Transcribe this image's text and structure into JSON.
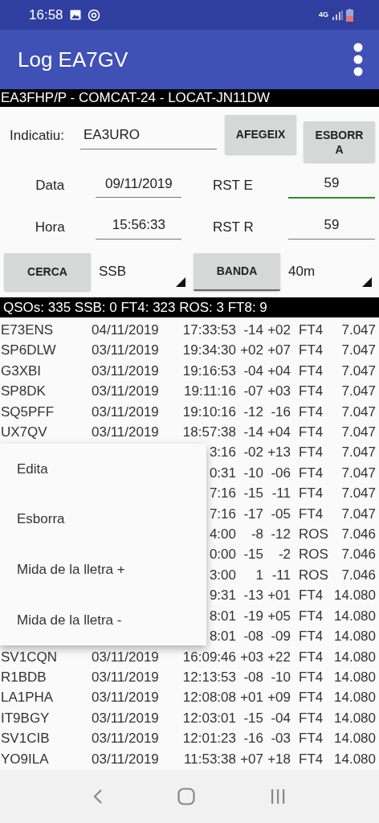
{
  "status_bar": {
    "time": "16:58",
    "network": "4G"
  },
  "app_bar": {
    "title": "Log EA7GV"
  },
  "info_banner": "EA3FHP/P - COMCAT-24 - LOCAT-JN11DW",
  "form": {
    "callsign": {
      "label": "Indicatiu:",
      "value": "EA3URO"
    },
    "buttons": [
      {
        "kind": "add",
        "label": "AFEGEIX"
      },
      {
        "kind": "delete",
        "label": "ESBORRA"
      }
    ],
    "fields": [
      {
        "label": "Data",
        "value": "09/11/2019",
        "focused": false
      },
      {
        "label": "RST E",
        "value": "59",
        "focused": true
      },
      {
        "label": "Hora",
        "value": "15:56:33",
        "focused": false
      },
      {
        "label": "RST R",
        "value": "59",
        "focused": false
      }
    ],
    "search_button": "CERCA",
    "mode_dropdown": "SSB",
    "band_button": "BANDA",
    "band_dropdown": "40m"
  },
  "stats": "QSOs: 335 SSB: 0  FT4: 323  ROS: 3  FT8: 9",
  "log_rows": [
    {
      "call": "E73ENS",
      "date": "04/11/2019",
      "time": "17:33:53",
      "rst_sent": "-14",
      "rst_rcvd": "+02",
      "mode": "FT4",
      "freq": "7.047"
    },
    {
      "call": "SP6DLW",
      "date": "03/11/2019",
      "time": "19:34:30",
      "rst_sent": "+02",
      "rst_rcvd": "+07",
      "mode": "FT4",
      "freq": "7.047"
    },
    {
      "call": "G3XBI",
      "date": "03/11/2019",
      "time": "19:16:53",
      "rst_sent": "-04",
      "rst_rcvd": "+04",
      "mode": "FT4",
      "freq": "7.047"
    },
    {
      "call": "SP8DK",
      "date": "03/11/2019",
      "time": "19:11:16",
      "rst_sent": "-07",
      "rst_rcvd": "+03",
      "mode": "FT4",
      "freq": "7.047"
    },
    {
      "call": "SQ5PFF",
      "date": "03/11/2019",
      "time": "19:10:16",
      "rst_sent": "-12",
      "rst_rcvd": "-16",
      "mode": "FT4",
      "freq": "7.047"
    },
    {
      "call": "UX7QV",
      "date": "03/11/2019",
      "time": "18:57:38",
      "rst_sent": "-14",
      "rst_rcvd": "+04",
      "mode": "FT4",
      "freq": "7.047"
    },
    {
      "time": "3:16",
      "rst_sent": "-02",
      "rst_rcvd": "+13",
      "mode": "FT4",
      "freq": "7.047"
    },
    {
      "time": "0:31",
      "rst_sent": "-10",
      "rst_rcvd": "-06",
      "mode": "FT4",
      "freq": "7.047"
    },
    {
      "time": "7:16",
      "rst_sent": "-15",
      "rst_rcvd": "-11",
      "mode": "FT4",
      "freq": "7.047"
    },
    {
      "time": "7:16",
      "rst_sent": "-17",
      "rst_rcvd": "-05",
      "mode": "FT4",
      "freq": "7.047"
    },
    {
      "time": "4:00",
      "rst_sent": "-8",
      "rst_rcvd": "-12",
      "mode": "ROS",
      "freq": "7.046"
    },
    {
      "time": "0:00",
      "rst_sent": "-15",
      "rst_rcvd": "-2",
      "mode": "ROS",
      "freq": "7.046"
    },
    {
      "time": "3:00",
      "rst_sent": "1",
      "rst_rcvd": "-11",
      "mode": "ROS",
      "freq": "7.046"
    },
    {
      "time": "9:31",
      "rst_sent": "-13",
      "rst_rcvd": "+01",
      "mode": "FT4",
      "freq": "14.080"
    },
    {
      "time": "8:01",
      "rst_sent": "-19",
      "rst_rcvd": "+05",
      "mode": "FT4",
      "freq": "14.080"
    },
    {
      "time": "8:01",
      "rst_sent": "-08",
      "rst_rcvd": "-09",
      "mode": "FT4",
      "freq": "14.080"
    },
    {
      "call": "SV1CQN",
      "date": "03/11/2019",
      "time": "16:09:46",
      "rst_sent": "+03",
      "rst_rcvd": "+22",
      "mode": "FT4",
      "freq": "14.080"
    },
    {
      "call": "R1BDB",
      "date": "03/11/2019",
      "time": "12:13:53",
      "rst_sent": "-08",
      "rst_rcvd": "-10",
      "mode": "FT4",
      "freq": "14.080"
    },
    {
      "call": "LA1PHA",
      "date": "03/11/2019",
      "time": "12:08:08",
      "rst_sent": "+01",
      "rst_rcvd": "+09",
      "mode": "FT4",
      "freq": "14.080"
    },
    {
      "call": "IT9BGY",
      "date": "03/11/2019",
      "time": "12:03:01",
      "rst_sent": "-15",
      "rst_rcvd": "-04",
      "mode": "FT4",
      "freq": "14.080"
    },
    {
      "call": "SV1CIB",
      "date": "03/11/2019",
      "time": "12:01:23",
      "rst_sent": "-16",
      "rst_rcvd": "-03",
      "mode": "FT4",
      "freq": "14.080"
    },
    {
      "call": "YO9ILA",
      "date": "03/11/2019",
      "time": "11:53:38",
      "rst_sent": "+07",
      "rst_rcvd": "+18",
      "mode": "FT4",
      "freq": "14.080"
    }
  ],
  "context_menu": [
    "Edita",
    "Esborra",
    "Mida de la lletra +",
    "Mida de la lletra -"
  ]
}
